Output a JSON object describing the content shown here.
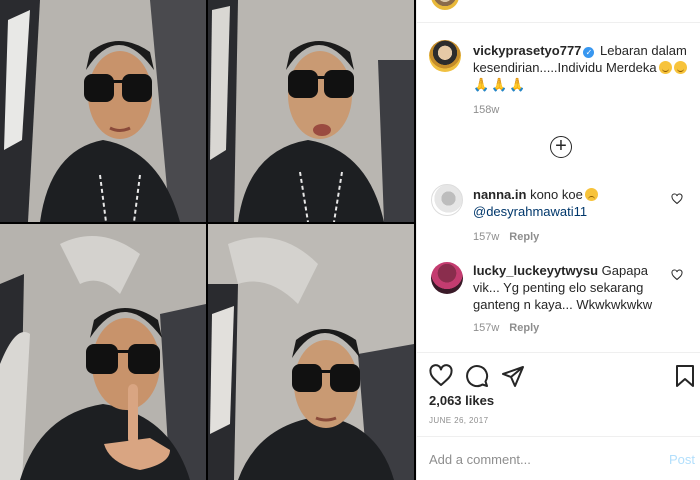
{
  "post": {
    "username": "vickyprasetyo777",
    "caption_text": "Lebaran dalam kesendirian.....Individu Merdeka",
    "caption_time": "158w",
    "likes": "2,063 likes",
    "date": "JUNE 26, 2017"
  },
  "comments": [
    {
      "username": "nanna.in",
      "text": "kono koe",
      "mention": "@desyrahmawati11",
      "time": "157w",
      "reply_label": "Reply"
    },
    {
      "username": "lucky_luckeyytwysu",
      "text": "Gapapa vik... Yg penting elo sekarang ganteng n kaya... Wkwkwkwkw",
      "time": "157w",
      "reply_label": "Reply"
    }
  ],
  "composer": {
    "placeholder": "Add a comment...",
    "post_label": "Post"
  },
  "icons": {
    "verified": "verified-badge-icon",
    "load_more": "plus-circle-icon",
    "like": "heart-icon",
    "comment": "comment-icon",
    "share": "share-icon",
    "save": "bookmark-icon"
  },
  "colors": {
    "text": "#262626",
    "muted": "#8e8e8e",
    "verified": "#3897f0",
    "mention": "#00376b",
    "post_disabled": "#b2dffc"
  }
}
